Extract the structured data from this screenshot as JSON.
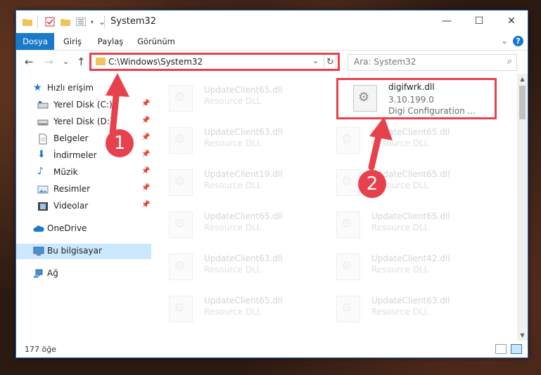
{
  "window": {
    "title": "System32"
  },
  "window_controls": {
    "minimize": "—",
    "maximize": "☐",
    "close": "✕"
  },
  "ribbon": {
    "tabs": [
      "Dosya",
      "Giriş",
      "Paylaş",
      "Görünüm"
    ],
    "collapse": "⌄",
    "help": "?"
  },
  "nav": {
    "back": "←",
    "forward": "→",
    "recent": "⌄",
    "up": "↑",
    "address": "C:\\Windows\\System32",
    "address_dropdown": "⌄",
    "refresh": "↻",
    "search_placeholder": "Ara: System32"
  },
  "nav_pane": {
    "items": [
      {
        "label": "Hızlı erişim",
        "icon": "star-icon"
      },
      {
        "label": "Yerel Disk (C:)",
        "icon": "drive-icon",
        "pinned": true
      },
      {
        "label": "Yerel Disk (D:)",
        "icon": "drive-icon",
        "pinned": true
      },
      {
        "label": "Belgeler",
        "icon": "document-icon",
        "pinned": true
      },
      {
        "label": "İndirmeler",
        "icon": "download-icon",
        "pinned": true
      },
      {
        "label": "Müzik",
        "icon": "music-icon",
        "pinned": true
      },
      {
        "label": "Resimler",
        "icon": "pictures-icon",
        "pinned": true
      },
      {
        "label": "Videolar",
        "icon": "video-icon",
        "pinned": true
      },
      {
        "label": "OneDrive",
        "icon": "cloud-icon"
      },
      {
        "label": "Bu bilgisayar",
        "icon": "computer-icon",
        "selected": true
      },
      {
        "label": "Ağ",
        "icon": "network-icon"
      }
    ],
    "pin_glyph": "📌"
  },
  "files": [
    {
      "name": "UpdateClient65.dll",
      "desc": "Resource DLL"
    },
    {
      "name": "digifwrk.dll",
      "version": "3.10.199.0",
      "desc": "Digi Configuration ...",
      "highlighted": true
    },
    {
      "name": "UpdateClient63.dll",
      "desc": "Resource DLL"
    },
    {
      "name": "UpdateClient65.dll",
      "desc": "Resource DLL"
    },
    {
      "name": "UpdateClient19.dll",
      "desc": "Resource DLL"
    },
    {
      "name": "UpdateClient65.dll",
      "desc": "Resource DLL"
    },
    {
      "name": "UpdateClient65.dll",
      "desc": "Resource DLL"
    },
    {
      "name": "UpdateClient65.dll",
      "desc": "Resource DLL"
    },
    {
      "name": "UpdateClient63.dll",
      "desc": "Resource DLL"
    },
    {
      "name": "UpdateClient42.dll",
      "desc": "Resource DLL"
    },
    {
      "name": "UpdateClient65.dll",
      "desc": "Resource DLL"
    },
    {
      "name": "UpdateClient63.dll",
      "desc": "Resource DLL"
    }
  ],
  "status": {
    "count": "177 öğe"
  },
  "annotations": {
    "badge1": "1",
    "badge2": "2",
    "color": "#e8414e"
  },
  "colors": {
    "accent": "#1979ca",
    "selection": "#cce8ff"
  }
}
